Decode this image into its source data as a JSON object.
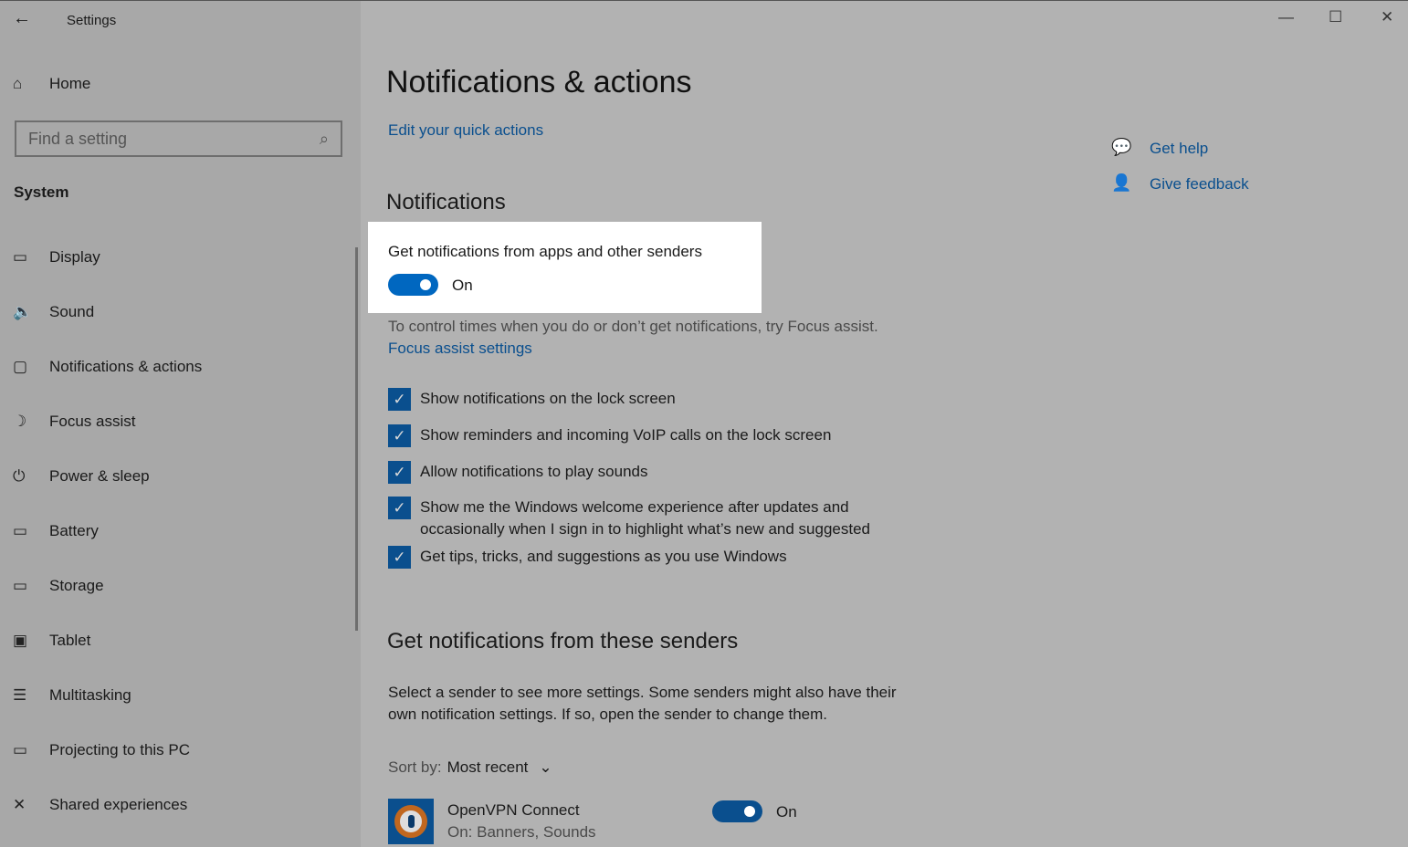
{
  "window": {
    "title": "Settings",
    "minimize": "—",
    "maximize": "☐",
    "close": "✕"
  },
  "sidebar": {
    "home": "Home",
    "search_placeholder": "Find a setting",
    "section": "System",
    "items": [
      {
        "label": "Display",
        "icon": "▭"
      },
      {
        "label": "Sound",
        "icon": "🔈"
      },
      {
        "label": "Notifications & actions",
        "icon": "▢"
      },
      {
        "label": "Focus assist",
        "icon": "☽"
      },
      {
        "label": "Power & sleep",
        "icon": "⏻"
      },
      {
        "label": "Battery",
        "icon": "▭"
      },
      {
        "label": "Storage",
        "icon": "▭"
      },
      {
        "label": "Tablet",
        "icon": "▣"
      },
      {
        "label": "Multitasking",
        "icon": "☰"
      },
      {
        "label": "Projecting to this PC",
        "icon": "▭"
      },
      {
        "label": "Shared experiences",
        "icon": "✕"
      }
    ]
  },
  "main": {
    "title": "Notifications & actions",
    "quick_actions_link": "Edit your quick actions",
    "section": "Notifications",
    "master_toggle": {
      "label": "Get notifications from apps and other senders",
      "state": "On"
    },
    "focus_text": "To control times when you do or don’t get notifications, try Focus assist.",
    "focus_link": "Focus assist settings",
    "checkboxes": [
      {
        "label": "Show notifications on the lock screen",
        "checked": true
      },
      {
        "label": "Show reminders and incoming VoIP calls on the lock screen",
        "checked": true
      },
      {
        "label": "Allow notifications to play sounds",
        "checked": true
      },
      {
        "label": "Show me the Windows welcome experience after updates and occasionally when I sign in to highlight what’s new and suggested",
        "checked": true
      },
      {
        "label": "Get tips, tricks, and suggestions as you use Windows",
        "checked": true
      }
    ],
    "senders_title": "Get notifications from these senders",
    "senders_desc": "Select a sender to see more settings. Some senders might also have their own notification settings. If so, open the sender to change them.",
    "sort_label": "Sort by:",
    "sort_value": "Most recent",
    "senders": [
      {
        "name": "OpenVPN Connect",
        "detail": "On: Banners, Sounds",
        "state": "On"
      }
    ]
  },
  "help": {
    "get_help": "Get help",
    "feedback": "Give feedback"
  },
  "colors": {
    "accent": "#0067c0",
    "accent_dim": "#0a4f8e"
  }
}
